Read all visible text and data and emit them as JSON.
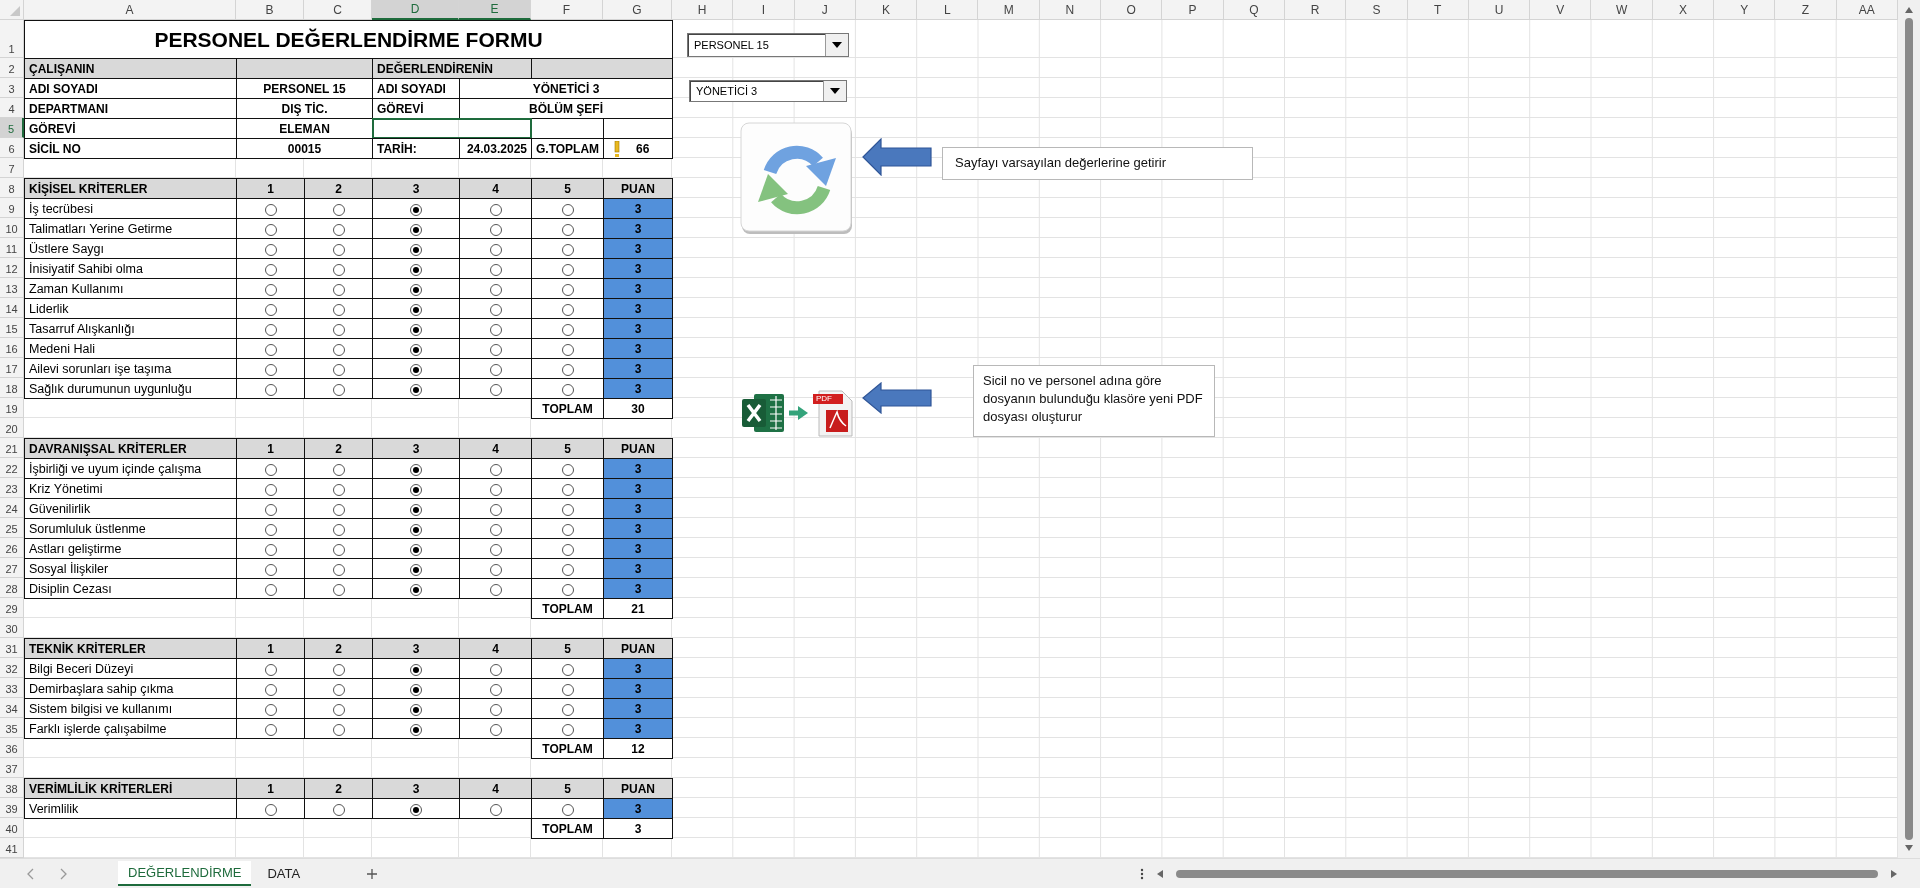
{
  "sheet": {
    "columns": [
      {
        "label": "A",
        "selected": false
      },
      {
        "label": "B",
        "selected": false
      },
      {
        "label": "C",
        "selected": false
      },
      {
        "label": "D",
        "selected": true
      },
      {
        "label": "E",
        "selected": true
      },
      {
        "label": "F",
        "selected": false
      },
      {
        "label": "G",
        "selected": false
      },
      {
        "label": "H",
        "selected": false
      },
      {
        "label": "I",
        "selected": false
      },
      {
        "label": "J",
        "selected": false
      },
      {
        "label": "K",
        "selected": false
      },
      {
        "label": "L",
        "selected": false
      },
      {
        "label": "M",
        "selected": false
      },
      {
        "label": "N",
        "selected": false
      },
      {
        "label": "O",
        "selected": false
      },
      {
        "label": "P",
        "selected": false
      },
      {
        "label": "Q",
        "selected": false
      },
      {
        "label": "R",
        "selected": false
      },
      {
        "label": "S",
        "selected": false
      },
      {
        "label": "T",
        "selected": false
      },
      {
        "label": "U",
        "selected": false
      },
      {
        "label": "V",
        "selected": false
      },
      {
        "label": "W",
        "selected": false
      },
      {
        "label": "X",
        "selected": false
      },
      {
        "label": "Y",
        "selected": false
      },
      {
        "label": "Z",
        "selected": false
      },
      {
        "label": "AA",
        "selected": false
      }
    ],
    "rows": [
      {
        "label": "1",
        "selected": false
      },
      {
        "label": "2",
        "selected": false
      },
      {
        "label": "3",
        "selected": false
      },
      {
        "label": "4",
        "selected": false
      },
      {
        "label": "5",
        "selected": true
      },
      {
        "label": "6",
        "selected": false
      },
      {
        "label": "7",
        "selected": false
      },
      {
        "label": "8",
        "selected": false
      },
      {
        "label": "9",
        "selected": false
      },
      {
        "label": "10",
        "selected": false
      },
      {
        "label": "11",
        "selected": false
      },
      {
        "label": "12",
        "selected": false
      },
      {
        "label": "13",
        "selected": false
      },
      {
        "label": "14",
        "selected": false
      },
      {
        "label": "15",
        "selected": false
      },
      {
        "label": "16",
        "selected": false
      },
      {
        "label": "17",
        "selected": false
      },
      {
        "label": "18",
        "selected": false
      },
      {
        "label": "19",
        "selected": false
      },
      {
        "label": "20",
        "selected": false
      },
      {
        "label": "21",
        "selected": false
      },
      {
        "label": "22",
        "selected": false
      },
      {
        "label": "23",
        "selected": false
      },
      {
        "label": "24",
        "selected": false
      },
      {
        "label": "25",
        "selected": false
      },
      {
        "label": "26",
        "selected": false
      },
      {
        "label": "27",
        "selected": false
      },
      {
        "label": "28",
        "selected": false
      },
      {
        "label": "29",
        "selected": false
      },
      {
        "label": "30",
        "selected": false
      },
      {
        "label": "31",
        "selected": false
      },
      {
        "label": "32",
        "selected": false
      },
      {
        "label": "33",
        "selected": false
      },
      {
        "label": "34",
        "selected": false
      },
      {
        "label": "35",
        "selected": false
      },
      {
        "label": "36",
        "selected": false
      },
      {
        "label": "37",
        "selected": false
      },
      {
        "label": "38",
        "selected": false
      },
      {
        "label": "39",
        "selected": false
      },
      {
        "label": "40",
        "selected": false
      },
      {
        "label": "41",
        "selected": false
      }
    ]
  },
  "form": {
    "title": "PERSONEL DEĞERLENDİRME FORMU",
    "employee_heading": "ÇALIŞANIN",
    "evaluator_heading": "DEĞERLENDİRENİN",
    "employee_fields": [
      {
        "label": "ADI SOYADI",
        "value": "PERSONEL 15"
      },
      {
        "label": "DEPARTMANI",
        "value": "DIŞ TİC."
      },
      {
        "label": "GÖREVİ",
        "value": "ELEMAN"
      },
      {
        "label": "SİCİL NO",
        "value": "00015"
      }
    ],
    "evaluator_fields": [
      {
        "label": "ADI SOYADI",
        "value": "YÖNETİCİ 3"
      },
      {
        "label": "GÖREVİ",
        "value": "BÖLÜM ŞEFİ"
      }
    ],
    "date_label": "TARİH:",
    "date": "24.03.2025",
    "grand_total_label": "G.TOPLAM",
    "grand_total": "66",
    "sections": [
      {
        "title": "KİŞİSEL KRİTERLER",
        "scale": [
          "1",
          "2",
          "3",
          "4",
          "5"
        ],
        "score_heading": "PUAN",
        "total_label": "TOPLAM",
        "total": "30",
        "criteria": [
          {
            "name": "İş tecrübesi",
            "score": "3",
            "options": [
              {
                "selected": false
              },
              {
                "selected": false
              },
              {
                "selected": true
              },
              {
                "selected": false
              },
              {
                "selected": false
              }
            ]
          },
          {
            "name": "Talimatları Yerine Getirme",
            "score": "3",
            "options": [
              {
                "selected": false
              },
              {
                "selected": false
              },
              {
                "selected": true
              },
              {
                "selected": false
              },
              {
                "selected": false
              }
            ]
          },
          {
            "name": "Üstlere Saygı",
            "score": "3",
            "options": [
              {
                "selected": false
              },
              {
                "selected": false
              },
              {
                "selected": true
              },
              {
                "selected": false
              },
              {
                "selected": false
              }
            ]
          },
          {
            "name": "İnisiyatif Sahibi olma",
            "score": "3",
            "options": [
              {
                "selected": false
              },
              {
                "selected": false
              },
              {
                "selected": true
              },
              {
                "selected": false
              },
              {
                "selected": false
              }
            ]
          },
          {
            "name": "Zaman Kullanımı",
            "score": "3",
            "options": [
              {
                "selected": false
              },
              {
                "selected": false
              },
              {
                "selected": true
              },
              {
                "selected": false
              },
              {
                "selected": false
              }
            ]
          },
          {
            "name": "Liderlik",
            "score": "3",
            "options": [
              {
                "selected": false
              },
              {
                "selected": false
              },
              {
                "selected": true
              },
              {
                "selected": false
              },
              {
                "selected": false
              }
            ]
          },
          {
            "name": "Tasarruf Alışkanlığı",
            "score": "3",
            "options": [
              {
                "selected": false
              },
              {
                "selected": false
              },
              {
                "selected": true
              },
              {
                "selected": false
              },
              {
                "selected": false
              }
            ]
          },
          {
            "name": "Medeni Hali",
            "score": "3",
            "options": [
              {
                "selected": false
              },
              {
                "selected": false
              },
              {
                "selected": true
              },
              {
                "selected": false
              },
              {
                "selected": false
              }
            ]
          },
          {
            "name": "Ailevi sorunları işe taşıma",
            "score": "3",
            "options": [
              {
                "selected": false
              },
              {
                "selected": false
              },
              {
                "selected": true
              },
              {
                "selected": false
              },
              {
                "selected": false
              }
            ]
          },
          {
            "name": "Sağlık durumunun uygunluğu",
            "score": "3",
            "options": [
              {
                "selected": false
              },
              {
                "selected": false
              },
              {
                "selected": true
              },
              {
                "selected": false
              },
              {
                "selected": false
              }
            ]
          }
        ]
      },
      {
        "title": "DAVRANIŞSAL KRİTERLER",
        "scale": [
          "1",
          "2",
          "3",
          "4",
          "5"
        ],
        "score_heading": "PUAN",
        "total_label": "TOPLAM",
        "total": "21",
        "criteria": [
          {
            "name": "İşbirliği ve uyum içinde çalışma",
            "score": "3",
            "options": [
              {
                "selected": false
              },
              {
                "selected": false
              },
              {
                "selected": true
              },
              {
                "selected": false
              },
              {
                "selected": false
              }
            ]
          },
          {
            "name": "Kriz Yönetimi",
            "score": "3",
            "options": [
              {
                "selected": false
              },
              {
                "selected": false
              },
              {
                "selected": true
              },
              {
                "selected": false
              },
              {
                "selected": false
              }
            ]
          },
          {
            "name": "Güvenilirlik",
            "score": "3",
            "options": [
              {
                "selected": false
              },
              {
                "selected": false
              },
              {
                "selected": true
              },
              {
                "selected": false
              },
              {
                "selected": false
              }
            ]
          },
          {
            "name": "Sorumluluk üstlenme",
            "score": "3",
            "options": [
              {
                "selected": false
              },
              {
                "selected": false
              },
              {
                "selected": true
              },
              {
                "selected": false
              },
              {
                "selected": false
              }
            ]
          },
          {
            "name": "Astları geliştirme",
            "score": "3",
            "options": [
              {
                "selected": false
              },
              {
                "selected": false
              },
              {
                "selected": true
              },
              {
                "selected": false
              },
              {
                "selected": false
              }
            ]
          },
          {
            "name": "Sosyal İlişkiler",
            "score": "3",
            "options": [
              {
                "selected": false
              },
              {
                "selected": false
              },
              {
                "selected": true
              },
              {
                "selected": false
              },
              {
                "selected": false
              }
            ]
          },
          {
            "name": "Disiplin Cezası",
            "score": "3",
            "options": [
              {
                "selected": false
              },
              {
                "selected": false
              },
              {
                "selected": true
              },
              {
                "selected": false
              },
              {
                "selected": false
              }
            ]
          }
        ]
      },
      {
        "title": "TEKNİK KRİTERLER",
        "scale": [
          "1",
          "2",
          "3",
          "4",
          "5"
        ],
        "score_heading": "PUAN",
        "total_label": "TOPLAM",
        "total": "12",
        "criteria": [
          {
            "name": "Bilgi Beceri Düzeyi",
            "score": "3",
            "options": [
              {
                "selected": false
              },
              {
                "selected": false
              },
              {
                "selected": true
              },
              {
                "selected": false
              },
              {
                "selected": false
              }
            ]
          },
          {
            "name": "Demirbaşlara sahip çıkma",
            "score": "3",
            "options": [
              {
                "selected": false
              },
              {
                "selected": false
              },
              {
                "selected": true
              },
              {
                "selected": false
              },
              {
                "selected": false
              }
            ]
          },
          {
            "name": "Sistem bilgisi ve kullanımı",
            "score": "3",
            "options": [
              {
                "selected": false
              },
              {
                "selected": false
              },
              {
                "selected": true
              },
              {
                "selected": false
              },
              {
                "selected": false
              }
            ]
          },
          {
            "name": "Farklı işlerde çalışabilme",
            "score": "3",
            "options": [
              {
                "selected": false
              },
              {
                "selected": false
              },
              {
                "selected": true
              },
              {
                "selected": false
              },
              {
                "selected": false
              }
            ]
          }
        ]
      },
      {
        "title": "VERİMLİLİK KRİTERLERİ",
        "scale": [
          "1",
          "2",
          "3",
          "4",
          "5"
        ],
        "score_heading": "PUAN",
        "total_label": "TOPLAM",
        "total": "3",
        "criteria": [
          {
            "name": "Verimlilik",
            "score": "3",
            "options": [
              {
                "selected": false
              },
              {
                "selected": false
              },
              {
                "selected": true
              },
              {
                "selected": false
              },
              {
                "selected": false
              }
            ]
          }
        ]
      }
    ]
  },
  "dropdowns": [
    {
      "value": "PERSONEL 15"
    },
    {
      "value": "YÖNETİCİ 3"
    }
  ],
  "notes": [
    "Sayfayı varsayılan değerlerine getirir",
    "Sicil no ve personel adına göre dosyanın bulunduğu klasöre yeni PDF dosyası oluşturur"
  ],
  "pdf_label": "PDF",
  "tabs": [
    {
      "label": "DEĞERLENDİRME",
      "selected": true
    },
    {
      "label": "DATA",
      "selected": false
    }
  ]
}
